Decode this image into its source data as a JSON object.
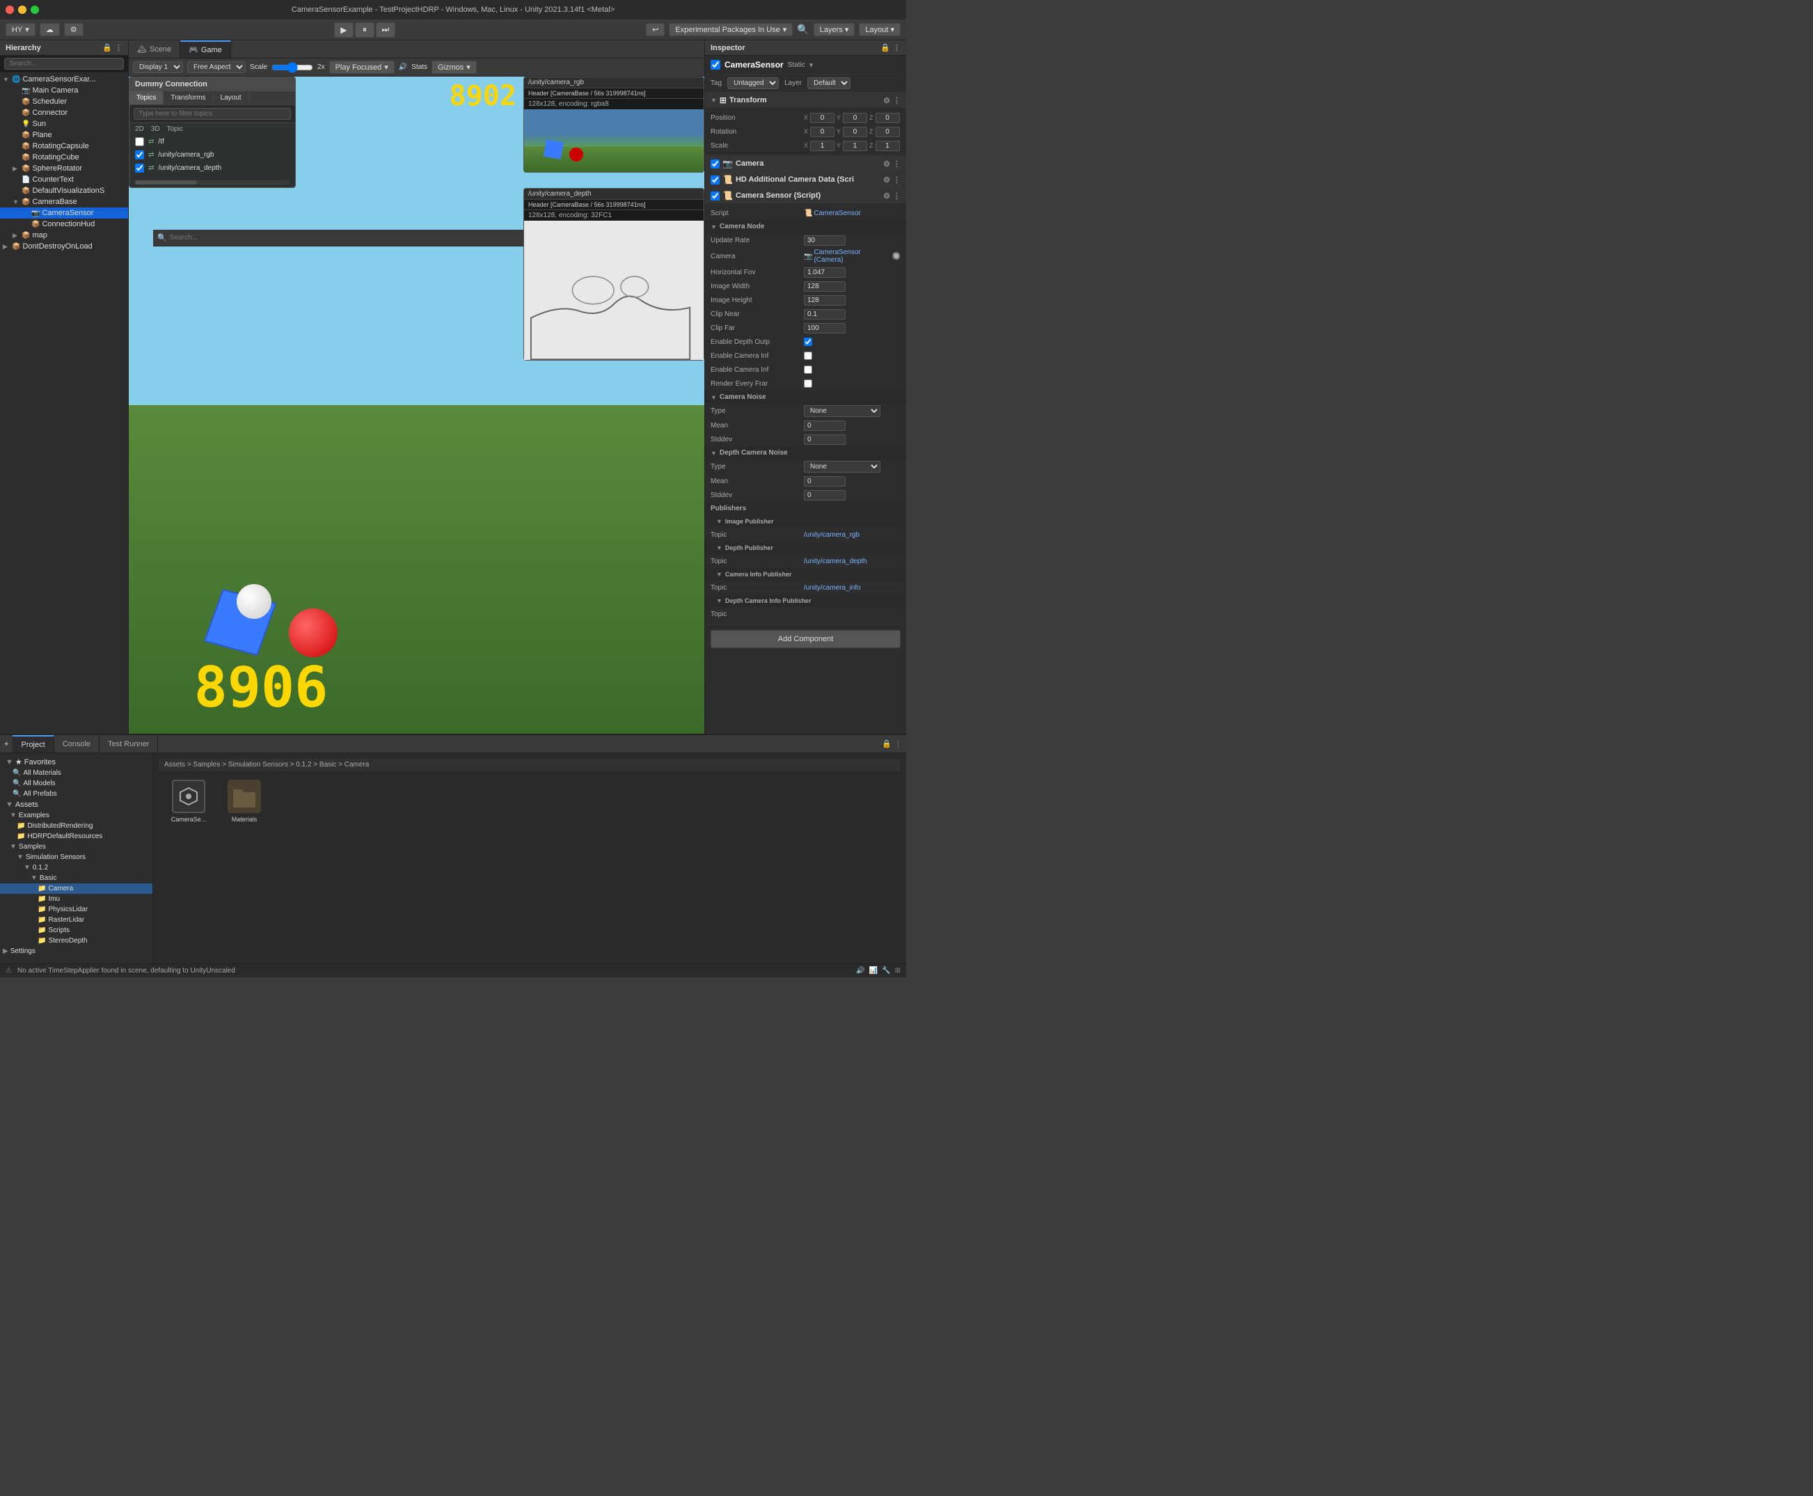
{
  "titleBar": {
    "title": "CameraSensorExample - TestProjectHDRP - Windows, Mac, Linux - Unity 2021.3.14f1 <Metal>"
  },
  "toolbar": {
    "accountLabel": "HY",
    "playLabel": "▶",
    "pauseLabel": "⏸",
    "stepLabel": "⏭",
    "cloudLabel": "☁",
    "settingsLabel": "⚙",
    "packagesLabel": "Experimental Packages In Use",
    "layersLabel": "Layers",
    "layoutLabel": "Layout"
  },
  "hierarchy": {
    "title": "Hierarchy",
    "searchPlaceholder": "Search...",
    "items": [
      {
        "id": "root",
        "label": "CameraSensorExar...",
        "indent": 0,
        "expanded": true,
        "icon": "🌐"
      },
      {
        "id": "maincamera",
        "label": "Main Camera",
        "indent": 1,
        "icon": "📷"
      },
      {
        "id": "scheduler",
        "label": "Scheduler",
        "indent": 1,
        "icon": "📦"
      },
      {
        "id": "connector",
        "label": "Connector",
        "indent": 1,
        "icon": "📦"
      },
      {
        "id": "sun",
        "label": "Sun",
        "indent": 1,
        "icon": "💡"
      },
      {
        "id": "plane",
        "label": "Plane",
        "indent": 1,
        "icon": "📦"
      },
      {
        "id": "rotatingcapsule",
        "label": "RotatingCapsule",
        "indent": 1,
        "icon": "📦"
      },
      {
        "id": "rotatingcube",
        "label": "RotatingCube",
        "indent": 1,
        "icon": "📦"
      },
      {
        "id": "sphererotator",
        "label": "SphereRotator",
        "indent": 1,
        "expanded": false,
        "icon": "📦"
      },
      {
        "id": "countertext",
        "label": "CounterText",
        "indent": 1,
        "icon": "📄"
      },
      {
        "id": "defaultvis",
        "label": "DefaultVisualizationS",
        "indent": 1,
        "icon": "📦"
      },
      {
        "id": "camerabase",
        "label": "CameraBase",
        "indent": 1,
        "expanded": true,
        "icon": "📦"
      },
      {
        "id": "camerasensor",
        "label": "CameraSensor",
        "indent": 2,
        "selected": true,
        "icon": "📷"
      },
      {
        "id": "connectionhud",
        "label": "ConnectionHud",
        "indent": 2,
        "icon": "📦"
      },
      {
        "id": "map",
        "label": "map",
        "indent": 1,
        "expanded": false,
        "icon": "📦"
      },
      {
        "id": "dontdestroy",
        "label": "DontDestroyOnLoad",
        "indent": 0,
        "expanded": false,
        "icon": "📦"
      }
    ]
  },
  "sceneTabs": [
    {
      "id": "scene",
      "label": "Scene",
      "icon": "🏔"
    },
    {
      "id": "game",
      "label": "Game",
      "active": true,
      "icon": "🎮"
    }
  ],
  "gameToolbar": {
    "displayLabel": "Display 1",
    "aspectLabel": "Free Aspect",
    "scaleLabel": "Scale",
    "scaleValue": "2x",
    "playFocusedLabel": "Play Focused",
    "statsLabel": "Stats",
    "gizmosLabel": "Gizmos"
  },
  "rosOverlay": {
    "title": "Dummy Connection",
    "tabs": [
      "Topics",
      "Transforms",
      "Layout"
    ],
    "activeTab": "Topics",
    "filterPlaceholder": "Type here to filter topics",
    "columns": [
      "2D",
      "3D",
      "Topic"
    ],
    "topics": [
      {
        "label": "/tf"
      },
      {
        "label": "/unity/camera_rgb"
      },
      {
        "label": "/unity/camera_depth"
      }
    ]
  },
  "cameraRgbFeed": {
    "topicTitle": "/unity/camera_rgb",
    "header": "Header [CameraBase / 56s 319998741ns]",
    "encoding": "128x128, encoding: rgba8"
  },
  "cameraDepthFeed": {
    "topicTitle": "/unity/camera_depth",
    "header": "Header [CameraBase / 56s 319998741ns]",
    "encoding": "128x128, encoding: 32FC1"
  },
  "bigNumber": "8906",
  "bigNumber2": "8902",
  "inspector": {
    "title": "Inspector",
    "objectName": "CameraSensor",
    "staticLabel": "Static",
    "tag": "Untagged",
    "layer": "Default",
    "components": [
      {
        "id": "transform",
        "label": "Transform",
        "icon": "⊞",
        "props": [
          {
            "label": "Position",
            "type": "xyz",
            "x": "0",
            "y": "0",
            "z": "0"
          },
          {
            "label": "Rotation",
            "type": "xyz",
            "x": "0",
            "y": "0",
            "z": "0"
          },
          {
            "label": "Scale",
            "type": "xyz",
            "x": "1",
            "y": "1",
            "z": "1"
          }
        ]
      },
      {
        "id": "camera",
        "label": "Camera",
        "icon": "📷"
      },
      {
        "id": "hddata",
        "label": "HD Additional Camera Data (Scri",
        "icon": "📜"
      },
      {
        "id": "camerasensor",
        "label": "Camera Sensor (Script)",
        "icon": "📜",
        "script": "CameraSensor",
        "props": [
          {
            "label": "Camera Node",
            "type": "section"
          },
          {
            "label": "Update Rate",
            "value": "30"
          },
          {
            "label": "Camera",
            "value": "CameraSensor (Camera)",
            "type": "ref"
          },
          {
            "label": "Horizontal Fov",
            "value": "1.047"
          },
          {
            "label": "Image Width",
            "value": "128"
          },
          {
            "label": "Image Height",
            "value": "128"
          },
          {
            "label": "Clip Near",
            "value": "0.1"
          },
          {
            "label": "Clip Far",
            "value": "100"
          },
          {
            "label": "Enable Depth Outp",
            "value": true,
            "type": "checkbox"
          },
          {
            "label": "Enable Camera Inf",
            "value": false,
            "type": "checkbox"
          },
          {
            "label": "Enable Camera Inf",
            "value": false,
            "type": "checkbox"
          },
          {
            "label": "Render Every Frar",
            "value": false,
            "type": "checkbox"
          },
          {
            "label": "Camera Noise",
            "type": "section"
          },
          {
            "label": "Type",
            "value": "None",
            "type": "dropdown"
          },
          {
            "label": "Mean",
            "value": "0"
          },
          {
            "label": "Stddev",
            "value": "0"
          },
          {
            "label": "Depth Camera Noise",
            "type": "section"
          },
          {
            "label": "Type",
            "value": "None",
            "type": "dropdown"
          },
          {
            "label": "Mean",
            "value": "0"
          },
          {
            "label": "Stddev",
            "value": "0"
          }
        ],
        "publishers": [
          {
            "group": "Publishers"
          },
          {
            "group": "Image Publisher"
          },
          {
            "label": "Topic",
            "value": "/unity/camera_rgb",
            "type": "topic"
          },
          {
            "group": "Depth Publisher"
          },
          {
            "label": "Topic",
            "value": "/unity/camera_depth",
            "type": "topic"
          },
          {
            "group": "Camera Info Publisher"
          },
          {
            "label": "Topic",
            "value": "/unity/camera_info",
            "type": "topic"
          },
          {
            "group": "Depth Camera Info Publisher"
          },
          {
            "label": "Topic",
            "value": ""
          }
        ]
      }
    ]
  },
  "projectTabs": [
    {
      "id": "project",
      "label": "Project",
      "active": true,
      "icon": "📁"
    },
    {
      "id": "console",
      "label": "Console",
      "icon": "💬"
    },
    {
      "id": "testrunner",
      "label": "Test Runner",
      "icon": "✓"
    }
  ],
  "projectTree": [
    {
      "id": "favorites",
      "label": "★ Favorites",
      "indent": 0,
      "expanded": true
    },
    {
      "id": "allmat",
      "label": "All Materials",
      "indent": 1
    },
    {
      "id": "allmod",
      "label": "All Models",
      "indent": 1
    },
    {
      "id": "allpre",
      "label": "All Prefabs",
      "indent": 1
    },
    {
      "id": "assets",
      "label": "Assets",
      "indent": 0,
      "expanded": true
    },
    {
      "id": "examples",
      "label": "Examples",
      "indent": 1,
      "expanded": true
    },
    {
      "id": "distributed",
      "label": "DistributedRendering",
      "indent": 2
    },
    {
      "id": "hdrpdefault",
      "label": "HDRPDefaultResources",
      "indent": 2
    },
    {
      "id": "samples",
      "label": "Samples",
      "indent": 1,
      "expanded": true
    },
    {
      "id": "simsensors",
      "label": "Simulation Sensors",
      "indent": 2,
      "expanded": true
    },
    {
      "id": "v012",
      "label": "0.1.2",
      "indent": 3,
      "expanded": true
    },
    {
      "id": "basic",
      "label": "Basic",
      "indent": 4,
      "expanded": true
    },
    {
      "id": "camera",
      "label": "Camera",
      "indent": 5,
      "selected": true
    },
    {
      "id": "imu",
      "label": "Imu",
      "indent": 5
    },
    {
      "id": "physicslidar",
      "label": "PhysicsLidar",
      "indent": 5
    },
    {
      "id": "rasterlidar",
      "label": "RasterLidar",
      "indent": 5
    },
    {
      "id": "scripts",
      "label": "Scripts",
      "indent": 5
    },
    {
      "id": "stereodepth",
      "label": "StereoDepth",
      "indent": 5
    },
    {
      "id": "settings",
      "label": "Settings",
      "indent": 0
    }
  ],
  "breadcrumb": "Assets > Samples > Simulation Sensors > 0.1.2 > Basic > Camera",
  "assets": [
    {
      "id": "camerase",
      "label": "CameraSe...",
      "type": "unity"
    },
    {
      "id": "materials",
      "label": "Materials",
      "type": "folder"
    }
  ],
  "statusBar": {
    "message": "No active TimeStepApplier found in scene, defaulting to UnityUnscaled"
  },
  "addComponentLabel": "Add Component"
}
